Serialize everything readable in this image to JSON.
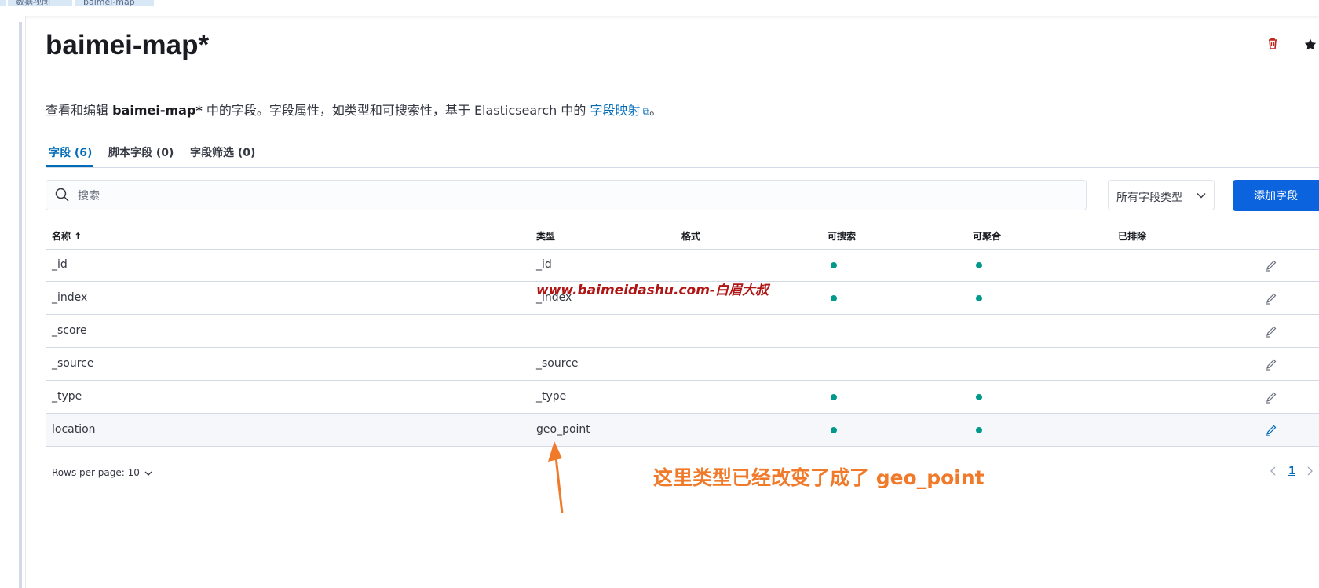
{
  "breadcrumbs": [
    "数据视图",
    "baimei-map"
  ],
  "title": "baimei-map*",
  "description": {
    "prefix": "查看和编辑 ",
    "name": "baimei-map*",
    "middle": " 中的字段。字段属性，如类型和可搜索性，基于 Elasticsearch 中的 ",
    "link": "字段映射",
    "suffix": "。"
  },
  "tabs": [
    {
      "label": "字段 (6)",
      "active": true
    },
    {
      "label": "脚本字段 (0)",
      "active": false
    },
    {
      "label": "字段筛选 (0)",
      "active": false
    }
  ],
  "search": {
    "placeholder": "搜索",
    "value": ""
  },
  "type_filter": {
    "label": "所有字段类型"
  },
  "add_button": "添加字段",
  "columns": {
    "name": "名称 ↑",
    "type": "类型",
    "format": "格式",
    "searchable": "可搜索",
    "aggregatable": "可聚合",
    "excluded": "已排除"
  },
  "rows": [
    {
      "name": "_id",
      "type": "_id",
      "searchable": true,
      "aggregatable": true
    },
    {
      "name": "_index",
      "type": "_index",
      "searchable": true,
      "aggregatable": true
    },
    {
      "name": "_score",
      "type": "",
      "searchable": false,
      "aggregatable": false
    },
    {
      "name": "_source",
      "type": "_source",
      "searchable": false,
      "aggregatable": false
    },
    {
      "name": "_type",
      "type": "_type",
      "searchable": true,
      "aggregatable": true
    },
    {
      "name": "location",
      "type": "geo_point",
      "searchable": true,
      "aggregatable": true
    }
  ],
  "pagination": {
    "rows_per_page": "Rows per page: 10",
    "current_page": "1"
  },
  "watermark": "www.baimeidashu.com-白眉大叔",
  "annotation": "这里类型已经改变了成了 geo_point",
  "colors": {
    "accent": "#006bb8",
    "primary_button": "#0b64dd",
    "dot": "#00998c",
    "annotation": "#f07a2a",
    "watermark": "#b11616"
  },
  "icons": [
    "search-icon",
    "chevron-down-icon",
    "pencil-icon",
    "trash-icon",
    "star-icon",
    "external-link-icon",
    "arrow-left-icon",
    "arrow-right-icon"
  ]
}
